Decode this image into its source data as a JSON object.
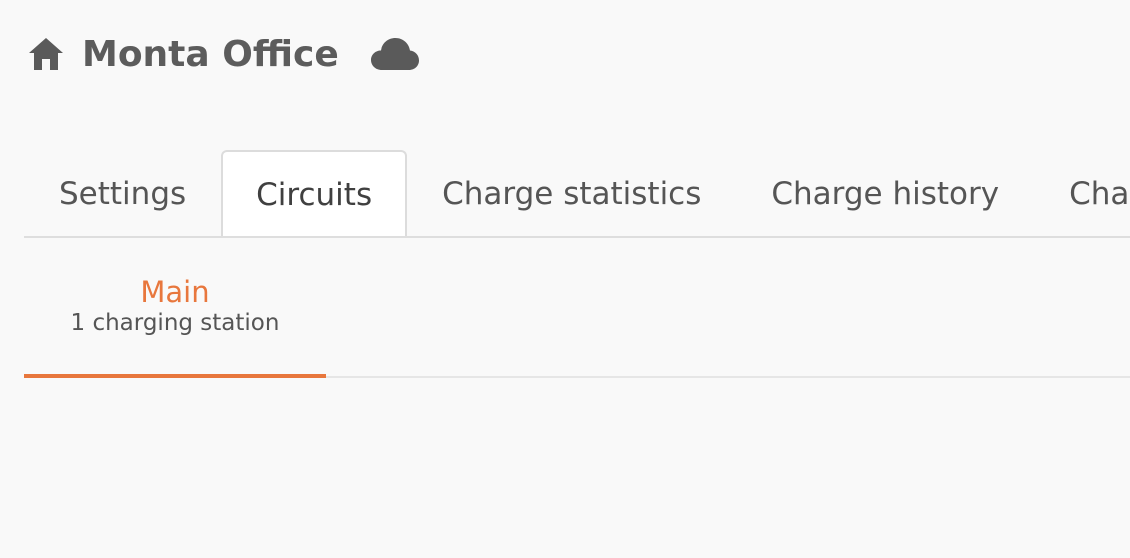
{
  "header": {
    "home_icon": "home-icon",
    "title": "Monta Office",
    "cloud_icon": "cloud-icon"
  },
  "tabs": [
    {
      "label": "Settings",
      "active": false
    },
    {
      "label": "Circuits",
      "active": true
    },
    {
      "label": "Charge statistics",
      "active": false
    },
    {
      "label": "Charge history",
      "active": false
    },
    {
      "label": "Charge rep",
      "active": false
    }
  ],
  "circuits": {
    "items": [
      {
        "name": "Main",
        "subtitle": "1 charging station",
        "active": true
      }
    ]
  },
  "colors": {
    "accent": "#e8773d",
    "text": "#5a5a5a",
    "background": "#f9f9f9"
  }
}
